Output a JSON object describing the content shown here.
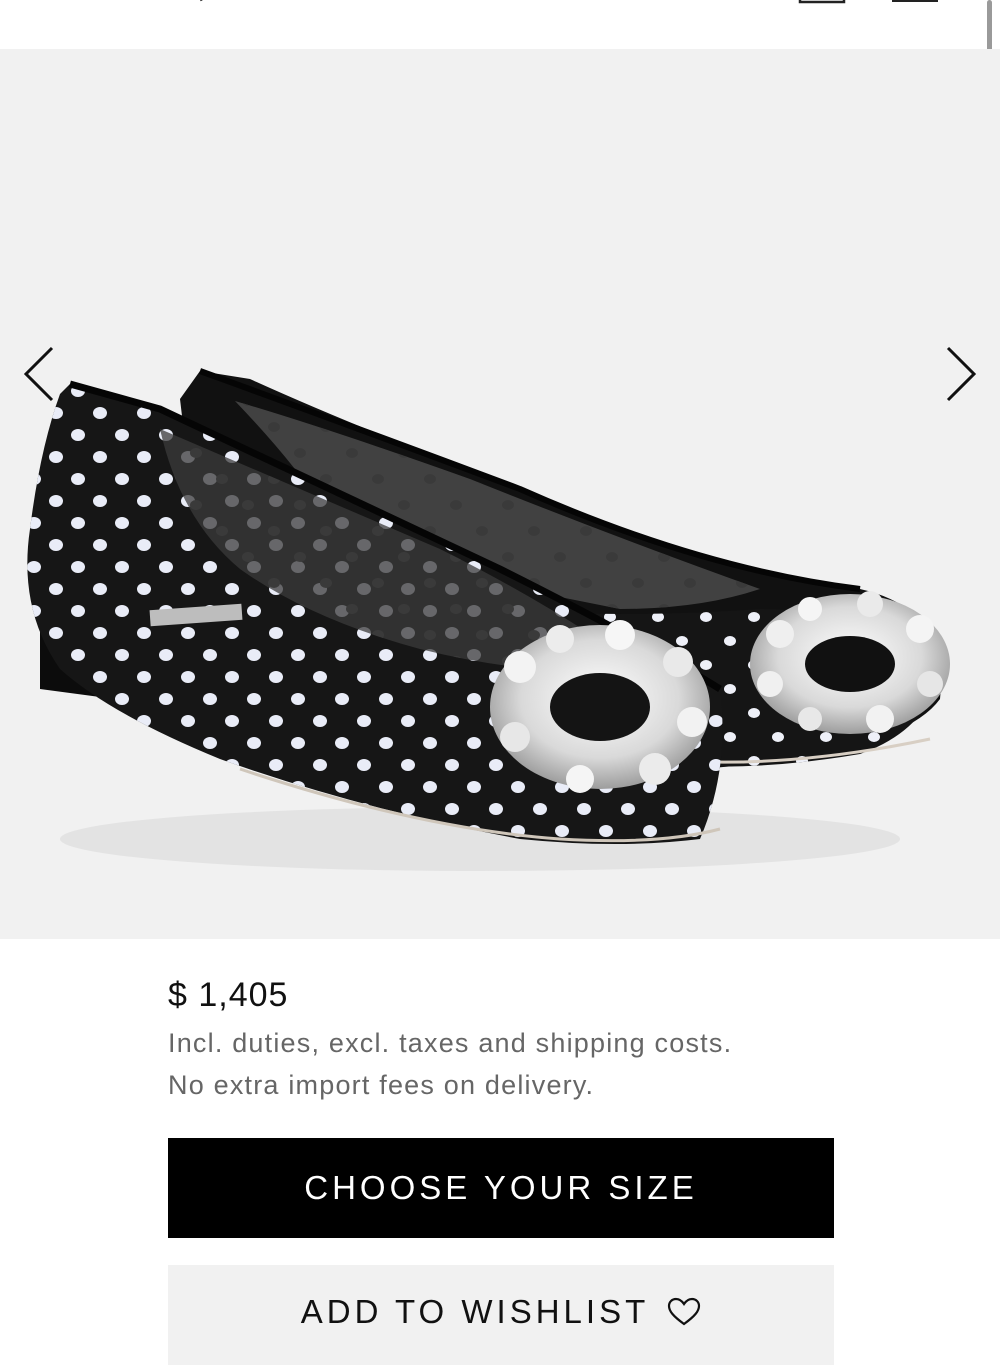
{
  "product": {
    "price": "$ 1,405",
    "price_note_line1": "Incl. duties, excl. taxes and shipping costs.",
    "price_note_line2": "No extra import fees on delivery."
  },
  "actions": {
    "choose_size_label": "CHOOSE YOUR SIZE",
    "wishlist_label": "ADD TO WISHLIST"
  },
  "icons": {
    "prev": "chevron-left-icon",
    "next": "chevron-right-icon",
    "wishlist": "heart-icon",
    "bag": "shopping-bag-icon",
    "menu": "menu-icon",
    "back": "back-arrow-icon"
  },
  "colors": {
    "primary_button": "#000000",
    "secondary_button": "#f1f1f1",
    "gallery_background": "#f1f1f1",
    "muted_text": "#666666"
  }
}
